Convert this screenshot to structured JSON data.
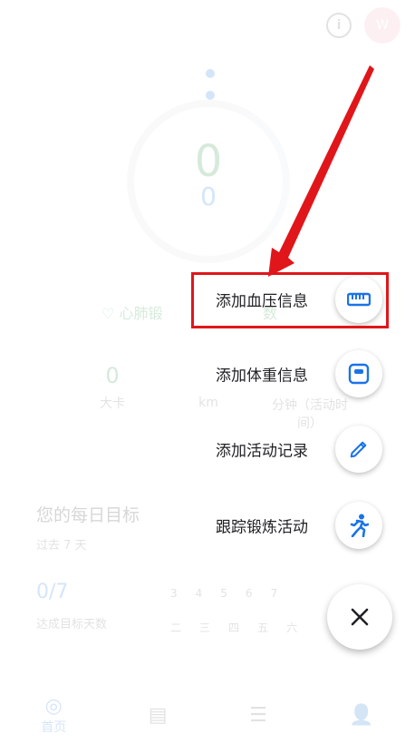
{
  "header": {
    "info_icon_glyph": "i",
    "avatar_letter": "W"
  },
  "summary": {
    "move_minutes": "0",
    "heart_points": "0",
    "cardio_label_left": "心肺锻",
    "cardio_label_right": "数"
  },
  "stats": [
    {
      "value": "0",
      "label": "大卡"
    },
    {
      "value": "",
      "label": "km"
    },
    {
      "value": "",
      "label": "分钟（活动时间）"
    }
  ],
  "goals": {
    "title": "您的每日目标",
    "subtitle": "过去 7 天",
    "count": "0/7",
    "count_label": "达成目标天数",
    "days_top": [
      "3",
      "4",
      "5",
      "6",
      "7"
    ],
    "days_bottom": [
      "二",
      "三",
      "四",
      "五",
      "六"
    ]
  },
  "bottom_nav": {
    "home_label": "首页"
  },
  "menu": {
    "items": [
      {
        "label": "添加血压信息",
        "icon": "ruler-icon"
      },
      {
        "label": "添加体重信息",
        "icon": "scale-icon"
      },
      {
        "label": "添加活动记录",
        "icon": "pencil-icon"
      },
      {
        "label": "跟踪锻炼活动",
        "icon": "running-icon"
      }
    ],
    "close_icon": "close-icon"
  },
  "colors": {
    "accent_blue": "#1a73e8",
    "accent_green": "#1e8e3e",
    "annotation_red": "#e0161a"
  }
}
